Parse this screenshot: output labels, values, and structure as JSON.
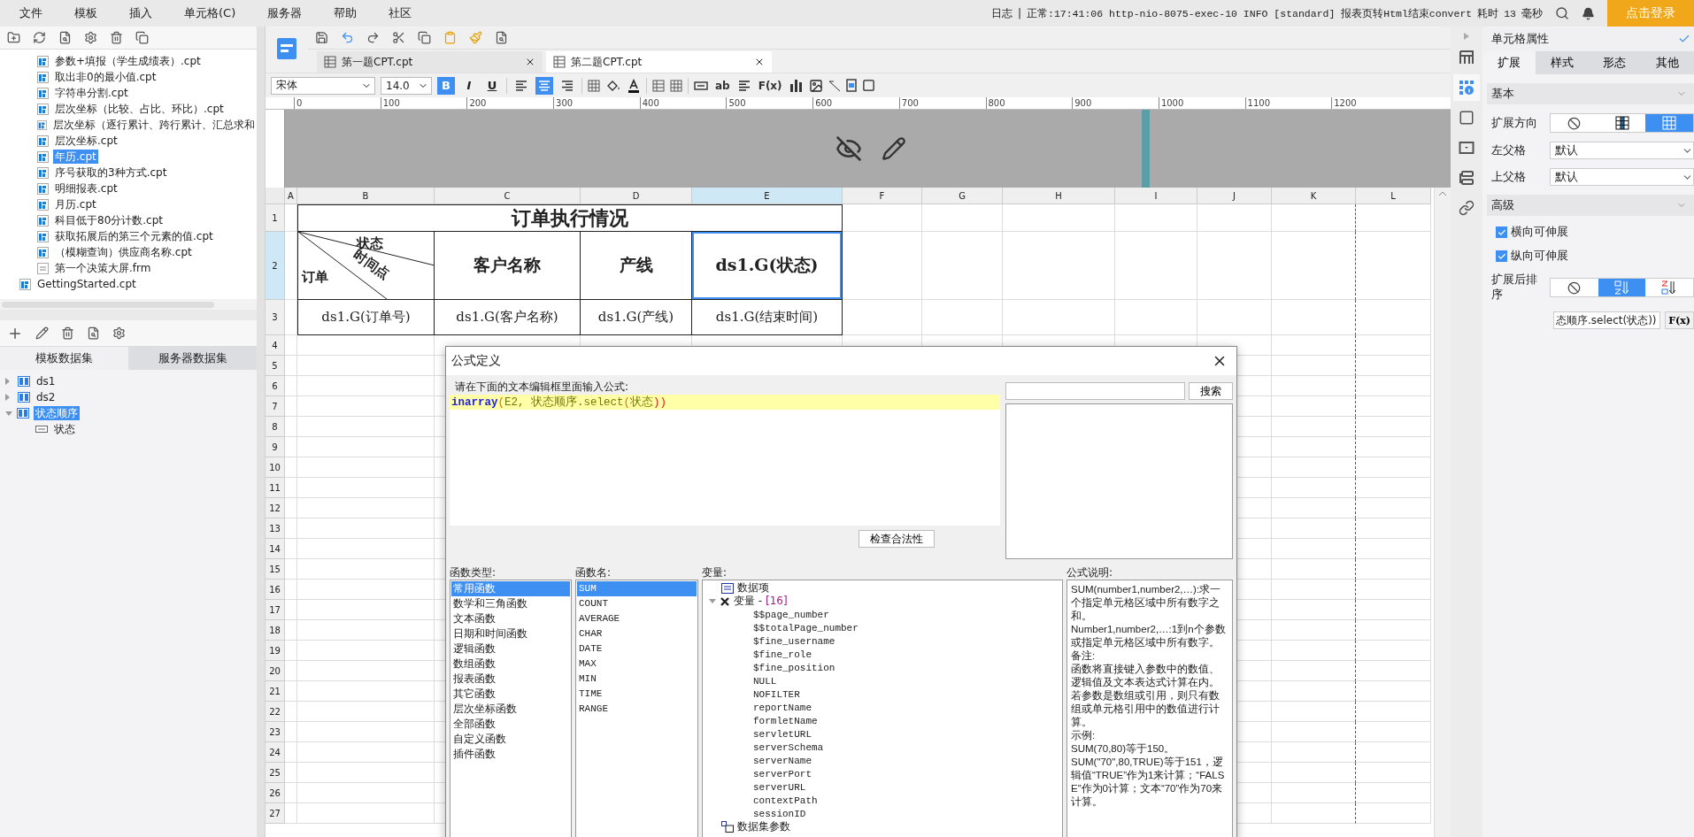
{
  "menu": [
    "文件",
    "模板",
    "插入",
    "单元格(C)",
    "服务器",
    "帮助",
    "社区"
  ],
  "log": {
    "label": "日志",
    "separator": "|",
    "message": "正常:17:41:06 http-nio-8075-exec-10 INFO [standard] 报表页转Html结束convert",
    "duration_label": "耗时",
    "duration": "13",
    "unit": "毫秒"
  },
  "login_button": "点击登录",
  "file_tree": {
    "folder_items": [
      {
        "label": "参数+填报（学生成绩表）.cpt",
        "kind": "cpt",
        "selected": false
      },
      {
        "label": "取出非0的最小值.cpt",
        "kind": "cpt",
        "selected": false
      },
      {
        "label": "字符串分割.cpt",
        "kind": "cpt",
        "selected": false
      },
      {
        "label": "层次坐标（比较、占比、环比）.cpt",
        "kind": "cpt",
        "selected": false
      },
      {
        "label": "层次坐标（逐行累计、跨行累计、汇总求和",
        "kind": "cpt",
        "selected": false
      },
      {
        "label": "层次坐标.cpt",
        "kind": "cpt",
        "selected": false
      },
      {
        "label": "年历.cpt",
        "kind": "cpt",
        "selected": true
      },
      {
        "label": "序号获取的3种方式.cpt",
        "kind": "cpt",
        "selected": false
      },
      {
        "label": "明细报表.cpt",
        "kind": "cpt",
        "selected": false
      },
      {
        "label": "月历.cpt",
        "kind": "cpt",
        "selected": false
      },
      {
        "label": "科目低于80分计数.cpt",
        "kind": "cpt",
        "selected": false
      },
      {
        "label": "获取拓展后的第三个元素的值.cpt",
        "kind": "cpt",
        "selected": false
      },
      {
        "label": "（模糊查询）供应商名称.cpt",
        "kind": "cpt",
        "selected": false
      },
      {
        "label": "第一个决策大屏.frm",
        "kind": "frm",
        "selected": false
      }
    ],
    "root_items": [
      {
        "label": "GettingStarted.cpt",
        "kind": "cpt",
        "selected": false
      }
    ]
  },
  "dataset_tabs": [
    {
      "label": "模板数据集",
      "selected": true
    },
    {
      "label": "服务器数据集",
      "selected": false
    }
  ],
  "datasets": [
    {
      "label": "ds1",
      "expanded": false,
      "selected": false
    },
    {
      "label": "ds2",
      "expanded": false,
      "selected": false
    },
    {
      "label": "状态顺序",
      "expanded": true,
      "selected": true,
      "children": [
        {
          "label": "状态"
        }
      ]
    }
  ],
  "doc_tabs": [
    {
      "label": "第一题CPT.cpt",
      "selected": false
    },
    {
      "label": "第二题CPT.cpt",
      "selected": true
    }
  ],
  "format": {
    "font_family": "宋体",
    "font_size": "14.0",
    "text_styles": [
      {
        "label": "B",
        "on": true
      },
      {
        "label": "I",
        "on": false
      },
      {
        "label": "U",
        "on": false
      }
    ],
    "alignment": [
      {
        "kind": "left",
        "selected": false
      },
      {
        "kind": "center",
        "selected": true
      },
      {
        "kind": "right",
        "selected": false
      }
    ],
    "text_button": "ab",
    "formula_button": "F(x)"
  },
  "ruler": [
    "0",
    "100",
    "200",
    "300",
    "400",
    "500",
    "600",
    "700",
    "800",
    "900",
    "1000",
    "1100",
    "1200"
  ],
  "sheet": {
    "columns": [
      {
        "label": "A",
        "selected": false
      },
      {
        "label": "B",
        "selected": false
      },
      {
        "label": "C",
        "selected": false
      },
      {
        "label": "D",
        "selected": false
      },
      {
        "label": "E",
        "selected": true
      },
      {
        "label": "F",
        "selected": false
      },
      {
        "label": "G",
        "selected": false
      },
      {
        "label": "H",
        "selected": false
      },
      {
        "label": "I",
        "selected": false
      },
      {
        "label": "J",
        "selected": false
      },
      {
        "label": "K",
        "selected": false
      },
      {
        "label": "L",
        "selected": false
      }
    ],
    "rows": [
      {
        "label": "1",
        "selected": false
      },
      {
        "label": "2",
        "selected": true
      },
      {
        "label": "3",
        "selected": false
      },
      {
        "label": "4",
        "selected": false
      },
      {
        "label": "5",
        "selected": false
      },
      {
        "label": "6",
        "selected": false
      },
      {
        "label": "7",
        "selected": false
      },
      {
        "label": "8",
        "selected": false
      },
      {
        "label": "9",
        "selected": false
      },
      {
        "label": "10",
        "selected": false
      },
      {
        "label": "11",
        "selected": false
      },
      {
        "label": "12",
        "selected": false
      },
      {
        "label": "13",
        "selected": false
      },
      {
        "label": "14",
        "selected": false
      },
      {
        "label": "15",
        "selected": false
      },
      {
        "label": "16",
        "selected": false
      },
      {
        "label": "17",
        "selected": false
      },
      {
        "label": "18",
        "selected": false
      },
      {
        "label": "19",
        "selected": false
      },
      {
        "label": "20",
        "selected": false
      },
      {
        "label": "21",
        "selected": false
      },
      {
        "label": "22",
        "selected": false
      },
      {
        "label": "23",
        "selected": false
      },
      {
        "label": "24",
        "selected": false
      },
      {
        "label": "25",
        "selected": false
      },
      {
        "label": "26",
        "selected": false
      },
      {
        "label": "27",
        "selected": false
      }
    ],
    "report": {
      "title": "订单执行情况",
      "diagonal_header": {
        "top": "状态",
        "middle": "时间点",
        "left": "订单"
      },
      "headers": [
        {
          "text": "客户名称",
          "selected": false
        },
        {
          "text": "产线",
          "selected": false
        },
        {
          "text": "ds1.G(状态)",
          "selected": true
        }
      ],
      "details": [
        "ds1.G(订单号)",
        "ds1.G(客户名称)",
        "ds1.G(产线)",
        "ds1.G(结束时间)"
      ]
    }
  },
  "dialog": {
    "title": "公式定义",
    "prompt": "请在下面的文本编辑框里面输入公式:",
    "formula": [
      {
        "text": "inarray",
        "kind": "keyword"
      },
      {
        "text": "(",
        "kind": "paren"
      },
      {
        "text": "E2, 状态顺序.select",
        "kind": "plain"
      },
      {
        "text": "(",
        "kind": "paren"
      },
      {
        "text": "状态",
        "kind": "plain"
      },
      {
        "text": "))",
        "kind": "close"
      }
    ],
    "search_button": "搜索",
    "check_button": "检查合法性",
    "function_types": {
      "label": "函数类型:",
      "items": [
        {
          "label": "常用函数",
          "selected": true
        },
        {
          "label": "数学和三角函数",
          "selected": false
        },
        {
          "label": "文本函数",
          "selected": false
        },
        {
          "label": "日期和时间函数",
          "selected": false
        },
        {
          "label": "逻辑函数",
          "selected": false
        },
        {
          "label": "数组函数",
          "selected": false
        },
        {
          "label": "报表函数",
          "selected": false
        },
        {
          "label": "其它函数",
          "selected": false
        },
        {
          "label": "层次坐标函数",
          "selected": false
        },
        {
          "label": "全部函数",
          "selected": false
        },
        {
          "label": "自定义函数",
          "selected": false
        },
        {
          "label": "插件函数",
          "selected": false
        }
      ]
    },
    "function_names": {
      "label": "函数名:",
      "items": [
        {
          "label": "SUM",
          "selected": true
        },
        {
          "label": "COUNT",
          "selected": false
        },
        {
          "label": "AVERAGE",
          "selected": false
        },
        {
          "label": "CHAR",
          "selected": false
        },
        {
          "label": "DATE",
          "selected": false
        },
        {
          "label": "MAX",
          "selected": false
        },
        {
          "label": "MIN",
          "selected": false
        },
        {
          "label": "TIME",
          "selected": false
        },
        {
          "label": "RANGE",
          "selected": false
        }
      ]
    },
    "variables": {
      "label": "变量:",
      "items": [
        {
          "label": "数据项",
          "kind": "item"
        },
        {
          "label": "变量 - ",
          "count": "[16]",
          "kind": "group",
          "expanded": true,
          "children": [
            {
              "label": "$$page_number"
            },
            {
              "label": "$$totalPage_number"
            },
            {
              "label": "$fine_username"
            },
            {
              "label": "$fine_role"
            },
            {
              "label": "$fine_position"
            },
            {
              "label": "NULL"
            },
            {
              "label": "NOFILTER"
            },
            {
              "label": "reportName"
            },
            {
              "label": "formletName"
            },
            {
              "label": "servletURL"
            },
            {
              "label": "serverSchema"
            },
            {
              "label": "serverName"
            },
            {
              "label": "serverPort"
            },
            {
              "label": "serverURL"
            },
            {
              "label": "contextPath"
            },
            {
              "label": "sessionID"
            }
          ]
        },
        {
          "label": "数据集参数",
          "kind": "params"
        }
      ]
    },
    "description": {
      "label": "公式说明:",
      "paragraphs": [
        "SUM(number1,number2,…):求一个指定单元格区域中所有数字之和。",
        "Number1,number2,…:1到n个参数或指定单元格区域中所有数字。",
        "备注:",
        "函数将直接键入参数中的数值、逻辑值及文本表达式计算在内。若参数是数组或引用，则只有数组或单元格引用中的数值进行计算。",
        "示例:",
        "SUM(70,80)等于150。",
        "SUM(\"70\",80,TRUE)等于151，逻辑值“TRUE”作为1来计算；“FALSE”作为0计算；文本“70”作为70来计算。"
      ]
    }
  },
  "side_tabs": [
    {
      "kind": "layout",
      "selected": false
    },
    {
      "kind": "cell",
      "selected": true
    },
    {
      "kind": "border",
      "selected": false
    },
    {
      "kind": "widget",
      "selected": false
    },
    {
      "kind": "condition",
      "selected": false
    },
    {
      "kind": "link",
      "selected": false
    }
  ],
  "properties": {
    "title": "单元格属性",
    "tabs": [
      {
        "label": "扩展",
        "selected": true
      },
      {
        "label": "样式",
        "selected": false
      },
      {
        "label": "形态",
        "selected": false
      },
      {
        "label": "其他",
        "selected": false
      }
    ],
    "basic": {
      "title": "基本",
      "expand_direction": {
        "label": "扩展方向",
        "options": [
          {
            "kind": "none",
            "selected": false
          },
          {
            "kind": "vertical",
            "selected": false
          },
          {
            "kind": "horizontal",
            "selected": true
          }
        ]
      },
      "left_parent": {
        "label": "左父格",
        "value": "默认"
      },
      "top_parent": {
        "label": "上父格",
        "value": "默认"
      }
    },
    "advanced": {
      "title": "高级",
      "checks": [
        {
          "label": "横向可伸展",
          "checked": true
        },
        {
          "label": "纵向可伸展",
          "checked": true
        }
      ],
      "sort": {
        "label": "扩展后排序",
        "options": [
          {
            "kind": "none",
            "selected": false
          },
          {
            "kind": "ascending",
            "selected": true
          },
          {
            "kind": "descending",
            "selected": false
          }
        ]
      },
      "sort_formula": "态顺序.select(状态))",
      "formula_button": "F(x)"
    }
  }
}
